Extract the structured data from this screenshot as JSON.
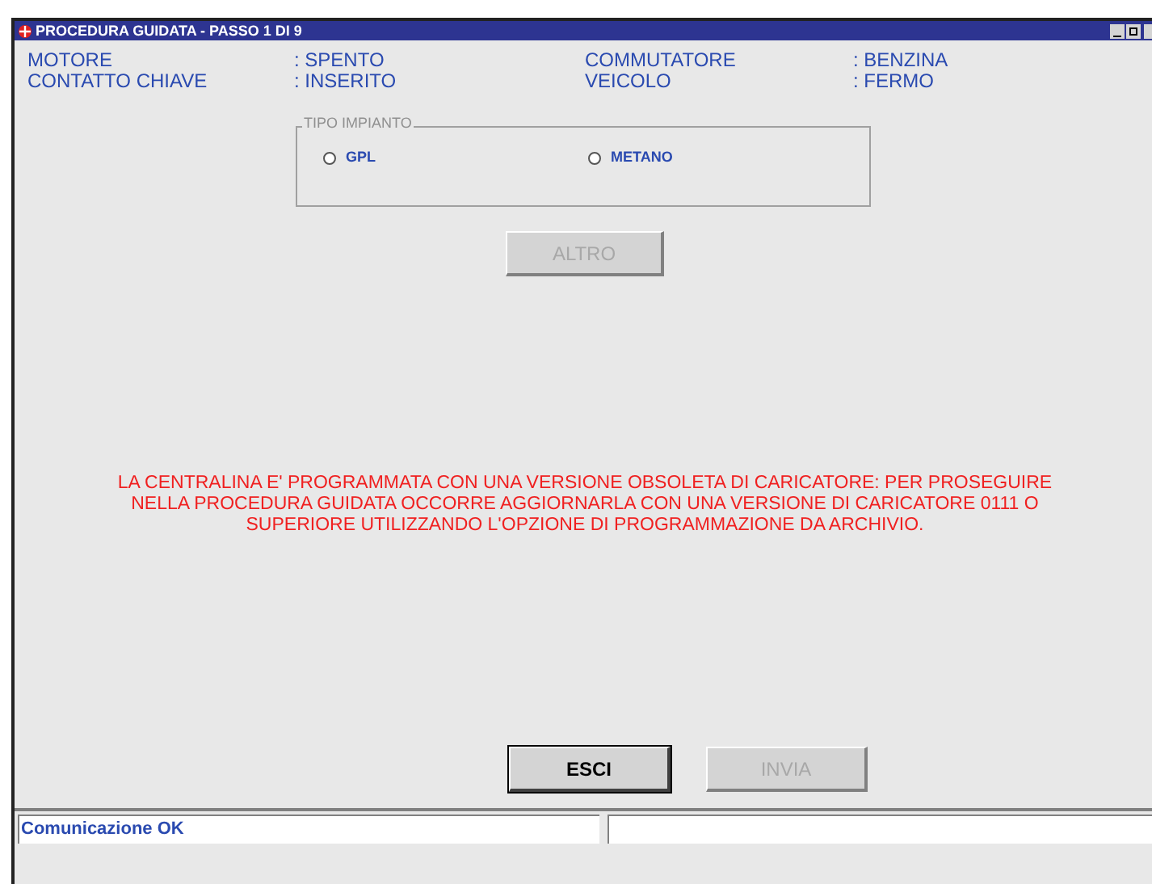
{
  "window": {
    "title": "PROCEDURA GUIDATA - PASSO 1 DI 9"
  },
  "status_info": [
    {
      "label": "MOTORE",
      "value": ": SPENTO"
    },
    {
      "label": "CONTATTO CHIAVE",
      "value": ": INSERITO"
    },
    {
      "label": "COMMUTATORE",
      "value": ": BENZINA"
    },
    {
      "label": "VEICOLO",
      "value": ": FERMO"
    }
  ],
  "group": {
    "title": "TIPO IMPIANTO",
    "options": [
      {
        "label": "GPL",
        "selected": false
      },
      {
        "label": "METANO",
        "selected": false
      }
    ]
  },
  "altro_button": {
    "label": "ALTRO",
    "disabled": true
  },
  "message": [
    "LA CENTRALINA E' PROGRAMMATA CON UNA VERSIONE OBSOLETA DI CARICATORE: PER PROSEGUIRE",
    "NELLA PROCEDURA GUIDATA OCCORRE AGGIORNARLA CON UNA VERSIONE DI CARICATORE 0111 O",
    "SUPERIORE UTILIZZANDO L'OPZIONE DI PROGRAMMAZIONE DA ARCHIVIO."
  ],
  "buttons": [
    {
      "label": "ESCI",
      "disabled": false
    },
    {
      "label": "INVIA",
      "disabled": true
    }
  ],
  "status_bar": {
    "text": "Comunicazione OK"
  }
}
